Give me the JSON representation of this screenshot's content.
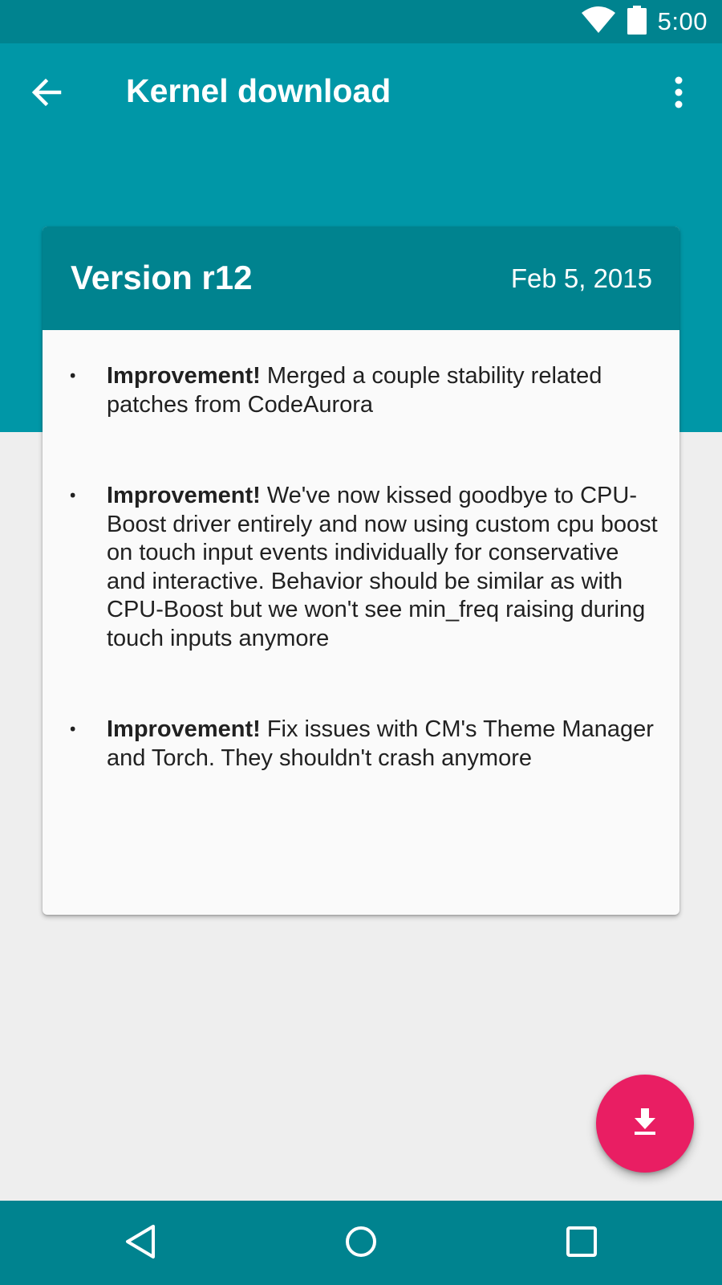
{
  "status_bar": {
    "time": "5:00",
    "icons": [
      "wifi-icon",
      "battery-icon"
    ]
  },
  "app_bar": {
    "title": "Kernel download",
    "back_icon": "arrow-back-icon",
    "overflow_icon": "more-vert-icon"
  },
  "release": {
    "version": "Version r12",
    "date": "Feb 5, 2015",
    "changes": [
      {
        "label": "Improvement!",
        "text": " Merged a couple stability related patches from CodeAurora"
      },
      {
        "label": "Improvement!",
        "text": " We've now kissed goodbye to CPU-Boost driver entirely and now using custom cpu boost on touch input events individually for conservative and interactive. Behavior should be similar as with CPU-Boost but we won't see min_freq raising during touch inputs anymore"
      },
      {
        "label": "Improvement!",
        "text": " Fix issues with CM's Theme Manager and Torch. They shouldn't crash anymore"
      }
    ]
  },
  "fab": {
    "icon": "download-icon"
  },
  "nav_bar": {
    "icons": [
      "nav-back-icon",
      "nav-home-icon",
      "nav-recents-icon"
    ]
  },
  "colors": {
    "primary": "#0097a7",
    "primary_dark": "#00838f",
    "accent": "#e91e63",
    "background": "#eeeeee",
    "card": "#fafafa"
  }
}
